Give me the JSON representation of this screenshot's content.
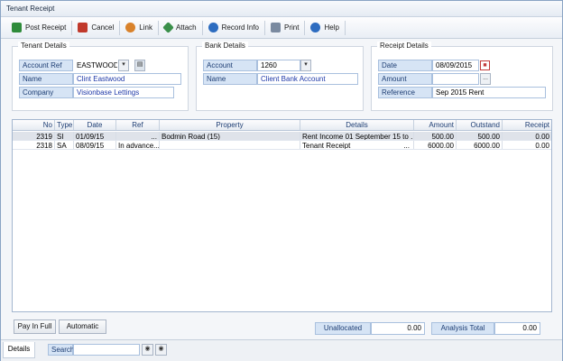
{
  "window": {
    "title": "Tenant Receipt"
  },
  "toolbar": {
    "buttons": [
      {
        "label": "Post Receipt",
        "icon": "post-receipt-icon",
        "color": "#2e8b3a"
      },
      {
        "label": "Cancel",
        "icon": "cancel-icon",
        "color": "#c0392b"
      },
      {
        "label": "Link",
        "icon": "link-icon",
        "color": "#d9822b"
      },
      {
        "label": "Attach",
        "icon": "attach-icon",
        "color": "#3a8f4a"
      },
      {
        "label": "Record Info",
        "icon": "record-info-icon",
        "color": "#2d6cc0"
      },
      {
        "label": "Print",
        "icon": "print-icon",
        "color": "#7a8aa0"
      },
      {
        "label": "Help",
        "icon": "help-icon",
        "color": "#2d6cc0"
      }
    ]
  },
  "tenant": {
    "legend": "Tenant Details",
    "account_ref_label": "Account Ref",
    "account_ref": "EASTWOOD",
    "name_label": "Name",
    "name": "Clint Eastwood",
    "company_label": "Company",
    "company": "Visionbase Lettings"
  },
  "bank": {
    "legend": "Bank Details",
    "account_label": "Account",
    "account": "1260",
    "name_label": "Name",
    "name": "Client Bank Account"
  },
  "receipt": {
    "legend": "Receipt Details",
    "date_label": "Date",
    "date": "08/09/2015",
    "amount_label": "Amount",
    "amount": "",
    "reference_label": "Reference",
    "reference": "Sep 2015 Rent"
  },
  "grid": {
    "headers": [
      "No",
      "Type",
      "Date",
      "Ref",
      "Property",
      "Details",
      "Amount",
      "Outstand",
      "Receipt"
    ],
    "rows": [
      {
        "no": "2319",
        "type": "SI",
        "date": "01/09/15",
        "ref": "...",
        "property": "Bodmin Road (15)",
        "details": "Rent Income 01 September 15 to ...",
        "amount": "500.00",
        "outstand": "500.00",
        "receipt": "0.00"
      },
      {
        "no": "2318",
        "type": "SA",
        "date": "08/09/15",
        "ref": "In advance...",
        "property": "",
        "details": "Tenant Receipt",
        "details_more": "...",
        "amount": "6000.00",
        "outstand": "6000.00",
        "receipt": "0.00"
      }
    ]
  },
  "footer": {
    "pay_in_full": "Pay In Full",
    "automatic": "Automatic",
    "unallocated_label": "Unallocated",
    "unallocated": "0.00",
    "analysis_total_label": "Analysis Total",
    "analysis_total": "0.00"
  },
  "bottom": {
    "tab": "Details",
    "search_label": "Search",
    "search_value": ""
  }
}
